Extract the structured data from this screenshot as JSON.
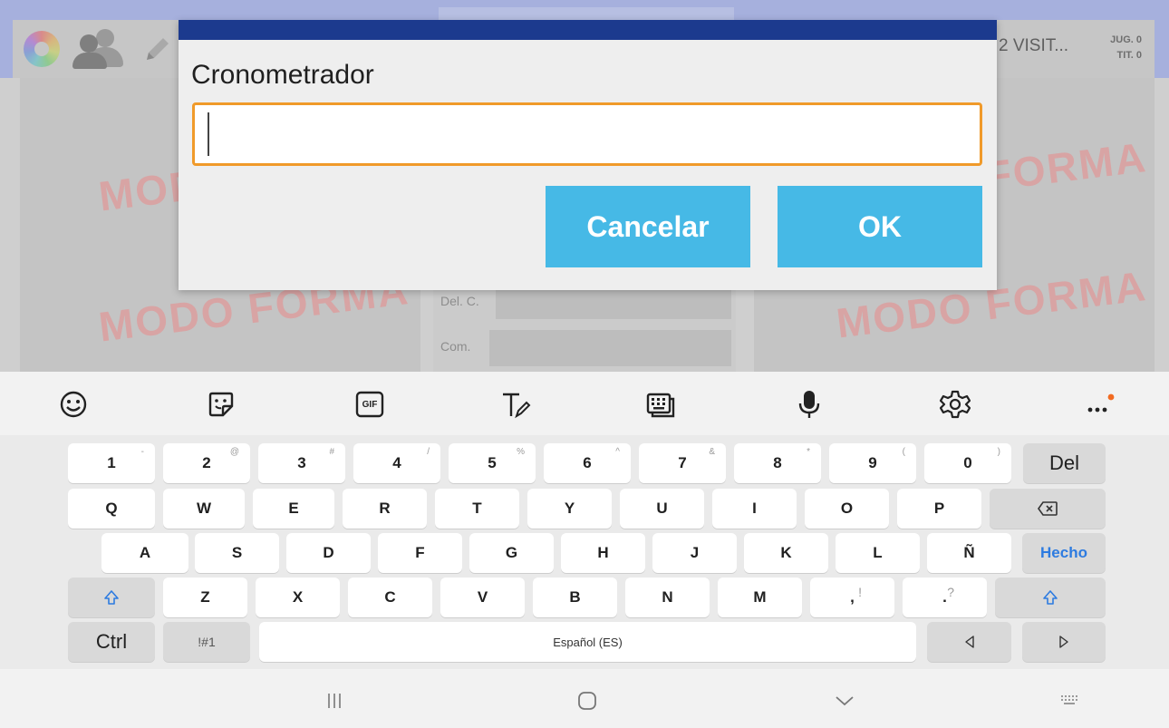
{
  "app": {
    "team_name": "2 VISIT...",
    "stats_players": "JUG. 0",
    "stats_starters": "TIT. 0",
    "watermark": "MODO FORMA",
    "rows": [
      {
        "label": "Del. C."
      },
      {
        "label": "Com."
      }
    ]
  },
  "dialog": {
    "title": "Cronometrador",
    "input_value": "",
    "cancel_label": "Cancelar",
    "ok_label": "OK",
    "accent_color": "#f09a2a",
    "button_color": "#46b9e6",
    "titlebar_color": "#1c3a8e"
  },
  "toolbar": {
    "icons": [
      "emoji-icon",
      "sticker-icon",
      "gif-icon",
      "handwriting-icon",
      "keyboard-mode-icon",
      "microphone-icon",
      "settings-icon",
      "more-icon"
    ],
    "gif_label": "GIF"
  },
  "keyboard": {
    "row1": [
      {
        "k": "1",
        "h": "-"
      },
      {
        "k": "2",
        "h": "@"
      },
      {
        "k": "3",
        "h": "#"
      },
      {
        "k": "4",
        "h": "/"
      },
      {
        "k": "5",
        "h": "%"
      },
      {
        "k": "6",
        "h": "^"
      },
      {
        "k": "7",
        "h": "&"
      },
      {
        "k": "8",
        "h": "*"
      },
      {
        "k": "9",
        "h": "("
      },
      {
        "k": "0",
        "h": ")"
      }
    ],
    "del_label": "Del",
    "row2": [
      "Q",
      "W",
      "E",
      "R",
      "T",
      "Y",
      "U",
      "I",
      "O",
      "P"
    ],
    "backspace_icon": "backspace-icon",
    "row3": [
      "A",
      "S",
      "D",
      "F",
      "G",
      "H",
      "J",
      "K",
      "L",
      "Ñ"
    ],
    "done_label": "Hecho",
    "row4": [
      "Z",
      "X",
      "C",
      "V",
      "B",
      "N",
      "M"
    ],
    "comma_key": {
      "k": ",",
      "h": "!"
    },
    "period_key": {
      "k": ".",
      "h": "?"
    },
    "ctrl_label": "Ctrl",
    "symbols_label": "!#1",
    "space_label": "Español (ES)"
  },
  "navbar": {
    "icons": [
      "recent-apps-icon",
      "home-icon",
      "back-icon",
      "keyboard-switch-icon"
    ]
  }
}
